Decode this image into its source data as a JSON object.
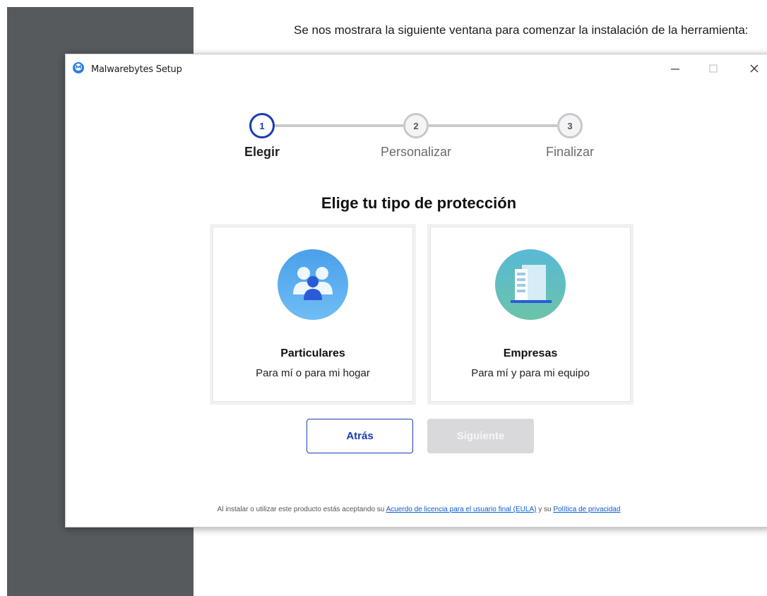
{
  "document": {
    "intro_text": "Se nos mostrara la siguiente ventana para comenzar la instalación de la herramienta:"
  },
  "window": {
    "title": "Malwarebytes Setup",
    "minimize_glyph": "–",
    "close_glyph": "✕"
  },
  "stepper": {
    "steps": [
      {
        "number": "1",
        "label": "Elegir",
        "state": "active"
      },
      {
        "number": "2",
        "label": "Personalizar",
        "state": "pending"
      },
      {
        "number": "3",
        "label": "Finalizar",
        "state": "pending"
      }
    ]
  },
  "main": {
    "heading": "Elige tu tipo de protección",
    "cards": [
      {
        "title": "Particulares",
        "subtitle": "Para mí o para mi hogar",
        "icon": "people-icon"
      },
      {
        "title": "Empresas",
        "subtitle": "Para mí y para mi equipo",
        "icon": "building-icon"
      }
    ]
  },
  "buttons": {
    "back_label": "Atrás",
    "next_label": "Siguiente"
  },
  "footer": {
    "prefix": "Al instalar o utilizar este producto estás aceptando su ",
    "eula_link": "Acuerdo de licencia para el usuario final (EULA)",
    "middle": " y su ",
    "privacy_link": "Política de privacidad"
  },
  "colors": {
    "accent": "#1a3bb3",
    "disabled_button": "#d9d9dc",
    "link": "#0b5cd6",
    "background_panel": "#565a5d"
  }
}
